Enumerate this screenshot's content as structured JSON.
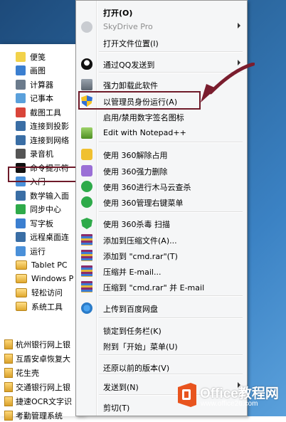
{
  "start_menu": {
    "items": [
      {
        "label": "便笺",
        "icon": "sticky-note-icon",
        "color": "#f2d24a"
      },
      {
        "label": "画图",
        "icon": "paint-icon",
        "color": "#3b7fd0"
      },
      {
        "label": "计算器",
        "icon": "calculator-icon",
        "color": "#6b7b8c"
      },
      {
        "label": "记事本",
        "icon": "notepad-icon",
        "color": "#5aa0db"
      },
      {
        "label": "截图工具",
        "icon": "snipping-tool-icon",
        "color": "#d9453a"
      },
      {
        "label": "连接到投影",
        "icon": "projector-icon",
        "color": "#3a6ea5"
      },
      {
        "label": "连接到网络",
        "icon": "network-projector-icon",
        "color": "#3a6ea5"
      },
      {
        "label": "录音机",
        "icon": "microphone-icon",
        "color": "#555555"
      },
      {
        "label": "命令提示符",
        "icon": "command-prompt-icon",
        "color": "#111111"
      },
      {
        "label": "入门",
        "icon": "getting-started-icon",
        "color": "#4a90d9"
      },
      {
        "label": "数学输入面",
        "icon": "math-input-icon",
        "color": "#3a6ea5"
      },
      {
        "label": "同步中心",
        "icon": "sync-center-icon",
        "color": "#2eaa4a"
      },
      {
        "label": "写字板",
        "icon": "wordpad-icon",
        "color": "#3b7fd0"
      },
      {
        "label": "远程桌面连",
        "icon": "remote-desktop-icon",
        "color": "#3a6ea5"
      },
      {
        "label": "运行",
        "icon": "run-icon",
        "color": "#4a90d9"
      },
      {
        "label": "Tablet PC",
        "icon": "folder-icon",
        "color": "#e0a82e"
      },
      {
        "label": "Windows P",
        "icon": "folder-icon",
        "color": "#e0a82e"
      },
      {
        "label": "轻松访问",
        "icon": "folder-icon",
        "color": "#e0a82e"
      },
      {
        "label": "系统工具",
        "icon": "folder-icon",
        "color": "#e0a82e"
      }
    ],
    "programs": [
      {
        "label": "杭州银行网上银"
      },
      {
        "label": "互盾安卓恢复大"
      },
      {
        "label": "花生壳"
      },
      {
        "label": "交通银行网上银"
      },
      {
        "label": "捷速OCR文字识"
      },
      {
        "label": "考勤管理系统"
      }
    ]
  },
  "context_menu": {
    "items": [
      {
        "label": "打开(O)",
        "bold": true,
        "icon": "",
        "disabled": false,
        "submenu": false
      },
      {
        "label": "SkyDrive Pro",
        "bold": false,
        "icon": "skydrive-icon",
        "disabled": true,
        "submenu": true
      },
      {
        "label": "打开文件位置(I)",
        "bold": false,
        "icon": "",
        "disabled": false,
        "submenu": false
      },
      {
        "label": "通过QQ发送到",
        "bold": false,
        "icon": "qq-penguin-icon",
        "disabled": false,
        "submenu": true
      },
      {
        "label": "强力卸载此软件",
        "bold": false,
        "icon": "uninstall-icon",
        "disabled": false,
        "submenu": false
      },
      {
        "label": "以管理员身份运行(A)",
        "bold": false,
        "icon": "uac-shield-icon",
        "disabled": false,
        "submenu": false
      },
      {
        "label": "启用/禁用数字签名图标",
        "bold": false,
        "icon": "",
        "disabled": false,
        "submenu": false
      },
      {
        "label": "Edit with Notepad++",
        "bold": false,
        "icon": "notepadpp-icon",
        "disabled": false,
        "submenu": false
      },
      {
        "label": "使用 360解除占用",
        "bold": false,
        "icon": "unlock-360-icon",
        "disabled": false,
        "submenu": false
      },
      {
        "label": "使用 360强力删除",
        "bold": false,
        "icon": "delete-360-icon",
        "disabled": false,
        "submenu": false
      },
      {
        "label": "使用 360进行木马云查杀",
        "bold": false,
        "icon": "scan-360-icon",
        "disabled": false,
        "submenu": false
      },
      {
        "label": "使用 360管理右键菜单",
        "bold": false,
        "icon": "menu-360-icon",
        "disabled": false,
        "submenu": false
      },
      {
        "label": "使用 360杀毒 扫描",
        "bold": false,
        "icon": "antivirus-360-icon",
        "disabled": false,
        "submenu": false
      },
      {
        "label": "添加到压缩文件(A)...",
        "bold": false,
        "icon": "winrar-icon",
        "disabled": false,
        "submenu": false
      },
      {
        "label": "添加到 \"cmd.rar\"(T)",
        "bold": false,
        "icon": "winrar-icon",
        "disabled": false,
        "submenu": false
      },
      {
        "label": "压缩并 E-mail...",
        "bold": false,
        "icon": "winrar-icon",
        "disabled": false,
        "submenu": false
      },
      {
        "label": "压缩到 \"cmd.rar\" 并 E-mail",
        "bold": false,
        "icon": "winrar-icon",
        "disabled": false,
        "submenu": false
      },
      {
        "label": "上传到百度网盘",
        "bold": false,
        "icon": "baidu-netdisk-icon",
        "disabled": false,
        "submenu": false
      },
      {
        "label": "锁定到任务栏(K)",
        "bold": false,
        "icon": "",
        "disabled": false,
        "submenu": false
      },
      {
        "label": "附到「开始」菜单(U)",
        "bold": false,
        "icon": "",
        "disabled": false,
        "submenu": false
      },
      {
        "label": "还原以前的版本(V)",
        "bold": false,
        "icon": "",
        "disabled": false,
        "submenu": false
      },
      {
        "label": "发送到(N)",
        "bold": false,
        "icon": "",
        "disabled": false,
        "submenu": true
      },
      {
        "label": "剪切(T)",
        "bold": false,
        "icon": "",
        "disabled": false,
        "submenu": false
      }
    ]
  },
  "watermark": {
    "title": "Office教程网",
    "subtitle": "www.office26.com",
    "logo_letter": "O"
  },
  "colors": {
    "highlight_border": "#6e1a29",
    "arrow": "#7a1d2e",
    "office_orange": "#e8541e"
  }
}
